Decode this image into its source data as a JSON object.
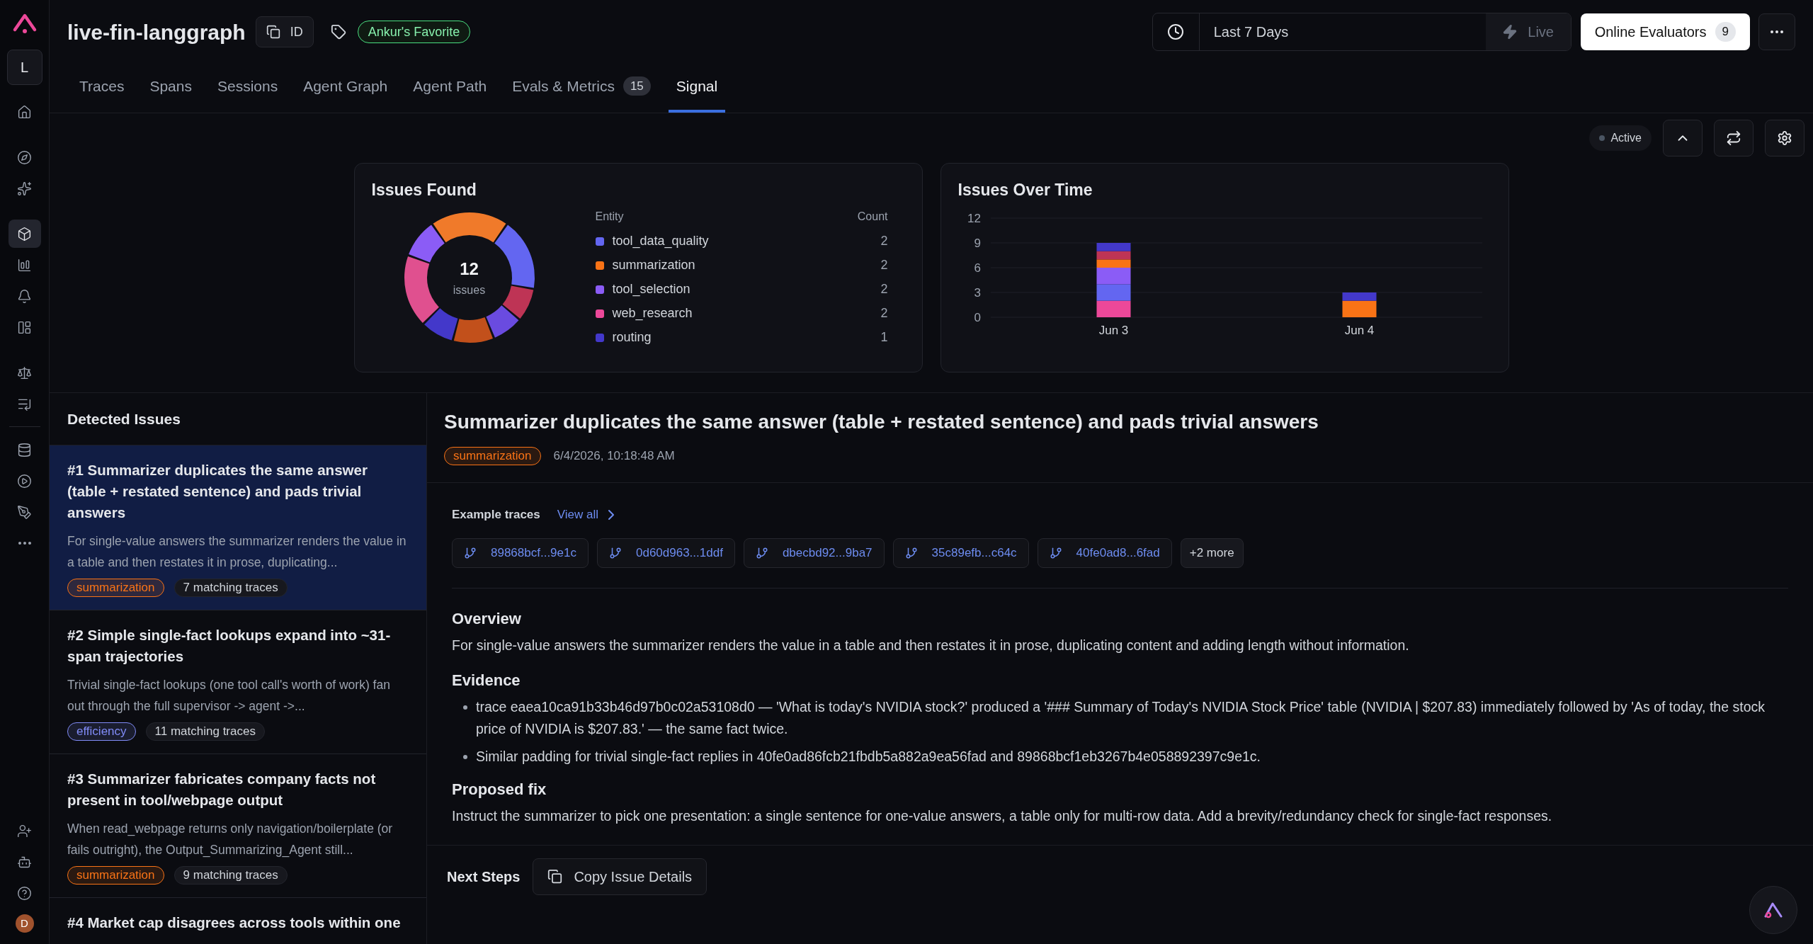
{
  "sidebar": {
    "workspace_initial": "L",
    "top_items": [
      {
        "selected": false
      },
      {
        "selected": false
      },
      {
        "selected": false
      },
      {
        "selected": true
      },
      {
        "selected": false
      },
      {
        "selected": false
      },
      {
        "selected": false
      },
      {
        "selected": false
      },
      {
        "selected": false
      },
      {
        "selected": false
      },
      {
        "selected": false
      },
      {
        "selected": false
      },
      {
        "selected": false
      }
    ],
    "bottom_items": [
      {
        "selected": false
      },
      {
        "selected": false
      },
      {
        "selected": false
      }
    ],
    "user_initial": "D"
  },
  "header": {
    "title": "live-fin-langgraph",
    "id_button": "ID",
    "tag": "Ankur's Favorite",
    "time_range": "Last 7 Days",
    "live_button": "Live",
    "evaluators_button": {
      "label": "Online Evaluators",
      "count": "9"
    }
  },
  "tabs": [
    {
      "label": "Traces",
      "selected": false
    },
    {
      "label": "Spans",
      "selected": false
    },
    {
      "label": "Sessions",
      "selected": false
    },
    {
      "label": "Agent Graph",
      "selected": false
    },
    {
      "label": "Agent Path",
      "selected": false
    },
    {
      "label": "Evals & Metrics",
      "badge": "15",
      "selected": false
    },
    {
      "label": "Signal",
      "selected": true
    }
  ],
  "toolbar": {
    "status": "Active"
  },
  "issues_found": {
    "title": "Issues Found",
    "total": "12",
    "total_label": "issues",
    "columns": [
      "Entity",
      "Count"
    ],
    "entities": [
      {
        "name": "tool_data_quality",
        "count": "2",
        "color": "#6366f1"
      },
      {
        "name": "summarization",
        "count": "2",
        "color": "#f97316"
      },
      {
        "name": "tool_selection",
        "count": "2",
        "color": "#8b5cf6"
      },
      {
        "name": "web_research",
        "count": "2",
        "color": "#ec4899"
      },
      {
        "name": "routing",
        "count": "1",
        "color": "#4338ca"
      }
    ]
  },
  "issues_over_time": {
    "title": "Issues Over Time",
    "chart_data": {
      "type": "bar",
      "stacked": true,
      "categories": [
        "Jun 3",
        "Jun 4"
      ],
      "ylim": [
        0,
        12
      ],
      "yticks": [
        0,
        3,
        6,
        9,
        12
      ],
      "series": [
        {
          "color": "#ec4899",
          "values": [
            2,
            0
          ]
        },
        {
          "color": "#6366f1",
          "values": [
            2,
            0
          ]
        },
        {
          "color": "#8b5cf6",
          "values": [
            2,
            0
          ]
        },
        {
          "color": "#f97316",
          "values": [
            1,
            2
          ]
        },
        {
          "color": "#be3455",
          "values": [
            1,
            0
          ]
        },
        {
          "color": "#4338ca",
          "values": [
            1,
            1
          ]
        }
      ],
      "grid": true
    }
  },
  "detected_issues": {
    "title": "Detected Issues",
    "items": [
      {
        "title": "#1 Summarizer duplicates the same answer (table + restated sentence) and pads trivial answers",
        "description": "For single-value answers the summarizer renders the value in a table and then restates it in prose, duplicating...",
        "tag": {
          "label": "summarization",
          "color": "#f97316"
        },
        "matching": "7 matching traces",
        "selected": true
      },
      {
        "title": "#2 Simple single-fact lookups expand into ~31-span trajectories",
        "description": "Trivial single-fact lookups (one tool call's worth of work) fan out through the full supervisor -> agent ->...",
        "tag": {
          "label": "efficiency",
          "color": "#818cf8"
        },
        "matching": "11 matching traces",
        "selected": false
      },
      {
        "title": "#3 Summarizer fabricates company facts not present in tool/webpage output",
        "description": "When read_webpage returns only navigation/boilerplate (or fails outright), the Output_Summarizing_Agent still...",
        "tag": {
          "label": "summarization",
          "color": "#f97316"
        },
        "matching": "9 matching traces",
        "selected": false
      },
      {
        "title": "#4 Market cap disagrees across tools within one",
        "selected": false
      }
    ]
  },
  "detail": {
    "title": "Summarizer duplicates the same answer (table + restated sentence) and pads trivial answers",
    "tag": {
      "label": "summarization",
      "color": "#f97316"
    },
    "timestamp": "6/4/2026, 10:18:48 AM",
    "example_traces": {
      "label": "Example traces",
      "view_all": "View all",
      "traces": [
        "89868bcf...9e1c",
        "0d60d963...1ddf",
        "dbecbd92...9ba7",
        "35c89efb...c64c",
        "40fe0ad8...6fad"
      ],
      "more": "+2 more"
    },
    "overview": {
      "heading": "Overview",
      "text": "For single-value answers the summarizer renders the value in a table and then restates it in prose, duplicating content and adding length without information."
    },
    "evidence": {
      "heading": "Evidence",
      "bullets": [
        "trace eaea10ca91b33b46d97b0c02a53108d0 — 'What is today's NVIDIA stock?' produced a '### Summary of Today's NVIDIA Stock Price' table (NVIDIA | $207.83) immediately followed by 'As of today, the stock price of NVIDIA is $207.83.' — the same fact twice.",
        "Similar padding for trivial single-fact replies in 40fe0ad86fcb21fbdb5a882a9ea56fad and 89868bcf1eb3267b4e058892397c9e1c."
      ]
    },
    "proposed_fix": {
      "heading": "Proposed fix",
      "text": "Instruct the summarizer to pick one presentation: a single sentence for one-value answers, a table only for multi-row data. Add a brevity/redundancy check for single-fact responses."
    },
    "next_steps": {
      "label": "Next Steps",
      "button": "Copy Issue Details"
    }
  }
}
